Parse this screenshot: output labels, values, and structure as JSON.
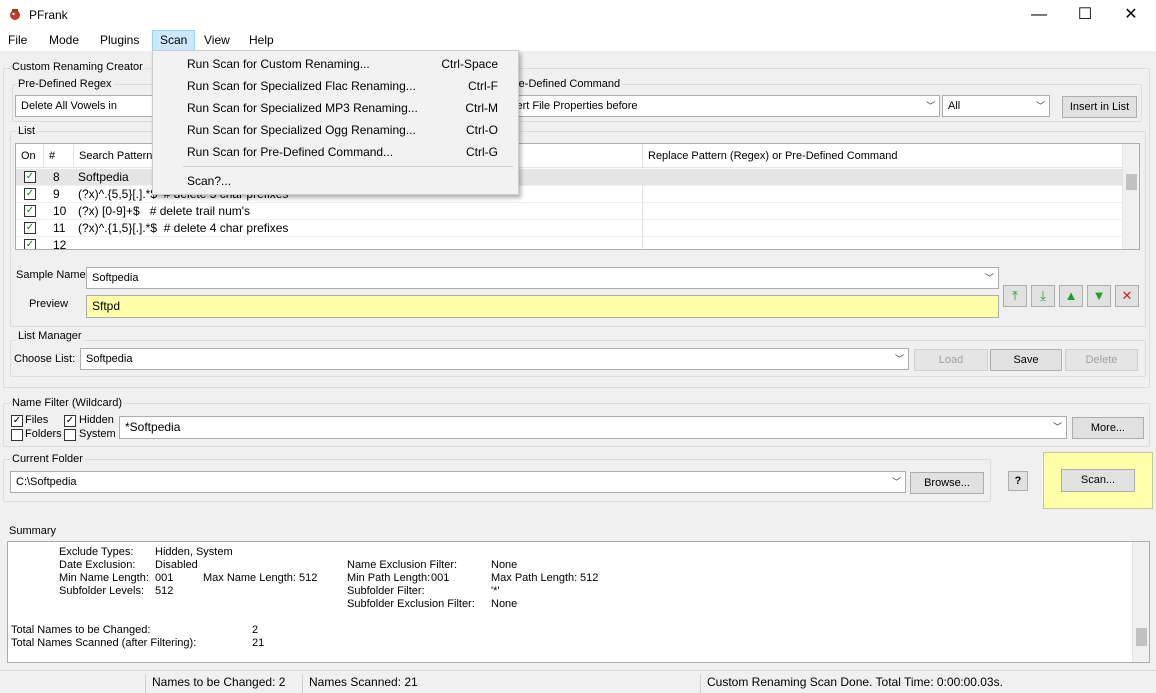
{
  "window": {
    "title": "PFrank",
    "minimize": "—",
    "maximize": "☐",
    "close": "✕"
  },
  "menubar": {
    "items": [
      {
        "label": "File"
      },
      {
        "label": "Mode"
      },
      {
        "label": "Plugins"
      },
      {
        "label": "Scan"
      },
      {
        "label": "View"
      },
      {
        "label": "Help"
      }
    ]
  },
  "scan_menu": {
    "items": [
      {
        "label": "Run Scan for Custom Renaming...",
        "shortcut": "Ctrl-Space"
      },
      {
        "label": "Run Scan for Specialized Flac Renaming...",
        "shortcut": "Ctrl-F"
      },
      {
        "label": "Run Scan for Specialized MP3 Renaming...",
        "shortcut": "Ctrl-M"
      },
      {
        "label": "Run Scan for Specialized Ogg Renaming...",
        "shortcut": "Ctrl-O"
      },
      {
        "label": "Run Scan for Pre-Defined Command...",
        "shortcut": "Ctrl-G"
      },
      {
        "label": "Scan?...",
        "shortcut": ""
      }
    ]
  },
  "creator": {
    "group_label": "Custom Renaming Creator",
    "predefined_regex_label": "Pre-Defined Regex",
    "predefined_regex_value": "Delete All Vowels in",
    "predefined_command_label": "re-Defined Command",
    "predefined_command_value": "sert File Properties before",
    "scope_value": "All",
    "insert_button": "Insert in List"
  },
  "list": {
    "group_label": "List",
    "columns": {
      "on": "On",
      "num": "#",
      "search": "Search Pattern",
      "replace": "Replace Pattern (Regex)  or  Pre-Defined Command"
    },
    "rows": [
      {
        "num": "8",
        "pattern": "Softpedia",
        "checked": "✓"
      },
      {
        "num": "9",
        "pattern": "(?x)^.{5,5}[.].*$  # delete 5 char prefixes",
        "checked": "✓"
      },
      {
        "num": "10",
        "pattern": "(?x) [0-9]+$   # delete trail num's",
        "checked": "✓"
      },
      {
        "num": "11",
        "pattern": "(?x)^.{1,5}[.].*$  # delete 4 char prefixes",
        "checked": "✓"
      },
      {
        "num": "12",
        "pattern": "",
        "checked": "✓"
      }
    ]
  },
  "sample": {
    "label": "Sample Name",
    "value": "Softpedia",
    "preview_label": "Preview",
    "preview_value": "Sftpd"
  },
  "list_manager": {
    "group_label": "List Manager",
    "choose_label": "Choose List:",
    "value": "Softpedia",
    "load": "Load",
    "save": "Save",
    "delete": "Delete"
  },
  "name_filter": {
    "group_label": "Name Filter (Wildcard)",
    "files": "Files",
    "hidden": "Hidden",
    "folders": "Folders",
    "system": "System",
    "value": "*Softpedia",
    "more": "More..."
  },
  "current_folder": {
    "group_label": "Current Folder",
    "value": "C:\\Softpedia",
    "browse": "Browse...",
    "help": "?",
    "scan": "Scan..."
  },
  "summary": {
    "group_label": "Summary",
    "exclude_types_label": "Exclude Types:",
    "exclude_types": "Hidden, System",
    "date_exclusion_label": "Date Exclusion:",
    "date_exclusion": "Disabled",
    "min_name_label": "Min Name Length:",
    "min_name": "001",
    "max_name_label": "Max Name Length:",
    "max_name": "512",
    "subfolder_levels_label": "Subfolder Levels:",
    "subfolder_levels": "512",
    "name_excl_label": "Name Exclusion Filter:",
    "name_excl": "None",
    "min_path_label": "Min Path Length:",
    "min_path": "001",
    "max_path_label": "Max Path Length:",
    "max_path": "512",
    "subfolder_filter_label": "Subfolder Filter:",
    "subfolder_filter": "'*'",
    "subfolder_excl_label": "Subfolder Exclusion Filter:",
    "subfolder_excl": "None",
    "total_changed_label": "Total Names to be Changed:",
    "total_changed": "2",
    "total_scanned_label": "Total Names Scanned (after Filtering):",
    "total_scanned": "21"
  },
  "status": {
    "changed": "Names to be Changed: 2",
    "scanned": "Names Scanned: 21",
    "message": "Custom Renaming Scan Done.  Total Time: 0:00:00.03s."
  },
  "colors": {
    "preview_bg": "#ffffa8",
    "scan_panel_bg": "#ffffa8",
    "menu_highlight": "#cce8ff"
  }
}
